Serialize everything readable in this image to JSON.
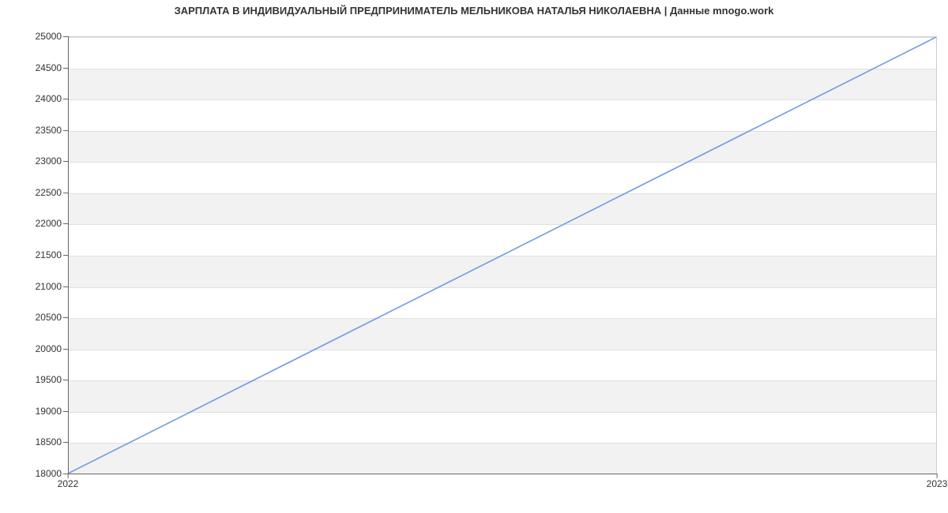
{
  "chart_data": {
    "type": "line",
    "title": "ЗАРПЛАТА В ИНДИВИДУАЛЬНЫЙ ПРЕДПРИНИМАТЕЛЬ МЕЛЬНИКОВА НАТАЛЬЯ НИКОЛАЕВНА | Данные mnogo.work",
    "x": [
      2022,
      2023
    ],
    "values": [
      18000,
      25000
    ],
    "xlabel": "",
    "ylabel": "",
    "x_ticks": [
      2022,
      2023
    ],
    "y_ticks": [
      18000,
      18500,
      19000,
      19500,
      20000,
      20500,
      21000,
      21500,
      22000,
      22500,
      23000,
      23500,
      24000,
      24500,
      25000
    ],
    "xlim": [
      2022,
      2023
    ],
    "ylim": [
      18000,
      25000
    ],
    "line_color": "#6f9ae3",
    "grid": true
  }
}
